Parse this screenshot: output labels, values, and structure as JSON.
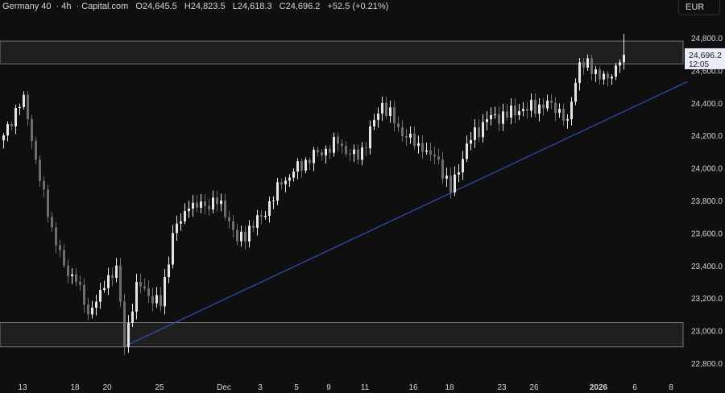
{
  "header": {
    "symbol": "Germany 40",
    "interval": "4h",
    "source": "Capital.com",
    "open": "O24,645.5",
    "high": "H24,823.5",
    "low": "L24,618.3",
    "close": "C24,696.2",
    "change": "+52.5 (+0.21%)"
  },
  "currency_button": "EUR",
  "last_price": {
    "price": "24,696.2",
    "countdown": "12:05"
  },
  "chart_data": {
    "type": "candlestick",
    "title": "Germany 40 · 4h · Capital.com",
    "ylim": [
      22800,
      24800
    ],
    "y_ticks": [
      "24,800.0",
      "24,600.0",
      "24,400.0",
      "24,200.0",
      "24,000.0",
      "23,800.0",
      "23,600.0",
      "23,400.0",
      "23,200.0",
      "23,000.0",
      "22,800.0"
    ],
    "y_tick_values": [
      24800,
      24600,
      24400,
      24200,
      24000,
      23800,
      23600,
      23400,
      23200,
      23000,
      22800
    ],
    "x_ticks": [
      {
        "label": "13",
        "bar": 5
      },
      {
        "label": "18",
        "bar": 18
      },
      {
        "label": "20",
        "bar": 26
      },
      {
        "label": "25",
        "bar": 39
      },
      {
        "label": "Dec",
        "bar": 55
      },
      {
        "label": "3",
        "bar": 64
      },
      {
        "label": "5",
        "bar": 73
      },
      {
        "label": "9",
        "bar": 81
      },
      {
        "label": "11",
        "bar": 90
      },
      {
        "label": "16",
        "bar": 102
      },
      {
        "label": "18",
        "bar": 111
      },
      {
        "label": "23",
        "bar": 124
      },
      {
        "label": "26",
        "bar": 132
      },
      {
        "label": "2026",
        "bar": 148,
        "bold": true
      },
      {
        "label": "6",
        "bar": 157
      },
      {
        "label": "8",
        "bar": 166
      }
    ],
    "close_waypoints": [
      [
        0,
        24200
      ],
      [
        5,
        24450
      ],
      [
        8,
        24050
      ],
      [
        11,
        23700
      ],
      [
        15,
        23400
      ],
      [
        18,
        23300
      ],
      [
        21,
        23100
      ],
      [
        24,
        23250
      ],
      [
        28,
        23400
      ],
      [
        30,
        22900
      ],
      [
        33,
        23300
      ],
      [
        39,
        23150
      ],
      [
        42,
        23600
      ],
      [
        46,
        23750
      ],
      [
        54,
        23800
      ],
      [
        58,
        23550
      ],
      [
        64,
        23700
      ],
      [
        69,
        23900
      ],
      [
        75,
        24050
      ],
      [
        83,
        24150
      ],
      [
        88,
        24050
      ],
      [
        94,
        24400
      ],
      [
        98,
        24250
      ],
      [
        104,
        24100
      ],
      [
        108,
        24050
      ],
      [
        111,
        23850
      ],
      [
        115,
        24150
      ],
      [
        120,
        24300
      ],
      [
        128,
        24350
      ],
      [
        136,
        24400
      ],
      [
        140,
        24300
      ],
      [
        143,
        24650
      ],
      [
        150,
        24550
      ],
      [
        153,
        24650
      ],
      [
        154,
        24696.2
      ]
    ],
    "zones": [
      {
        "from": 24640,
        "to": 24780
      },
      {
        "from": 22900,
        "to": 23050
      }
    ],
    "trendline": [
      [
        30,
        22900
      ],
      [
        170,
        24530
      ]
    ]
  }
}
